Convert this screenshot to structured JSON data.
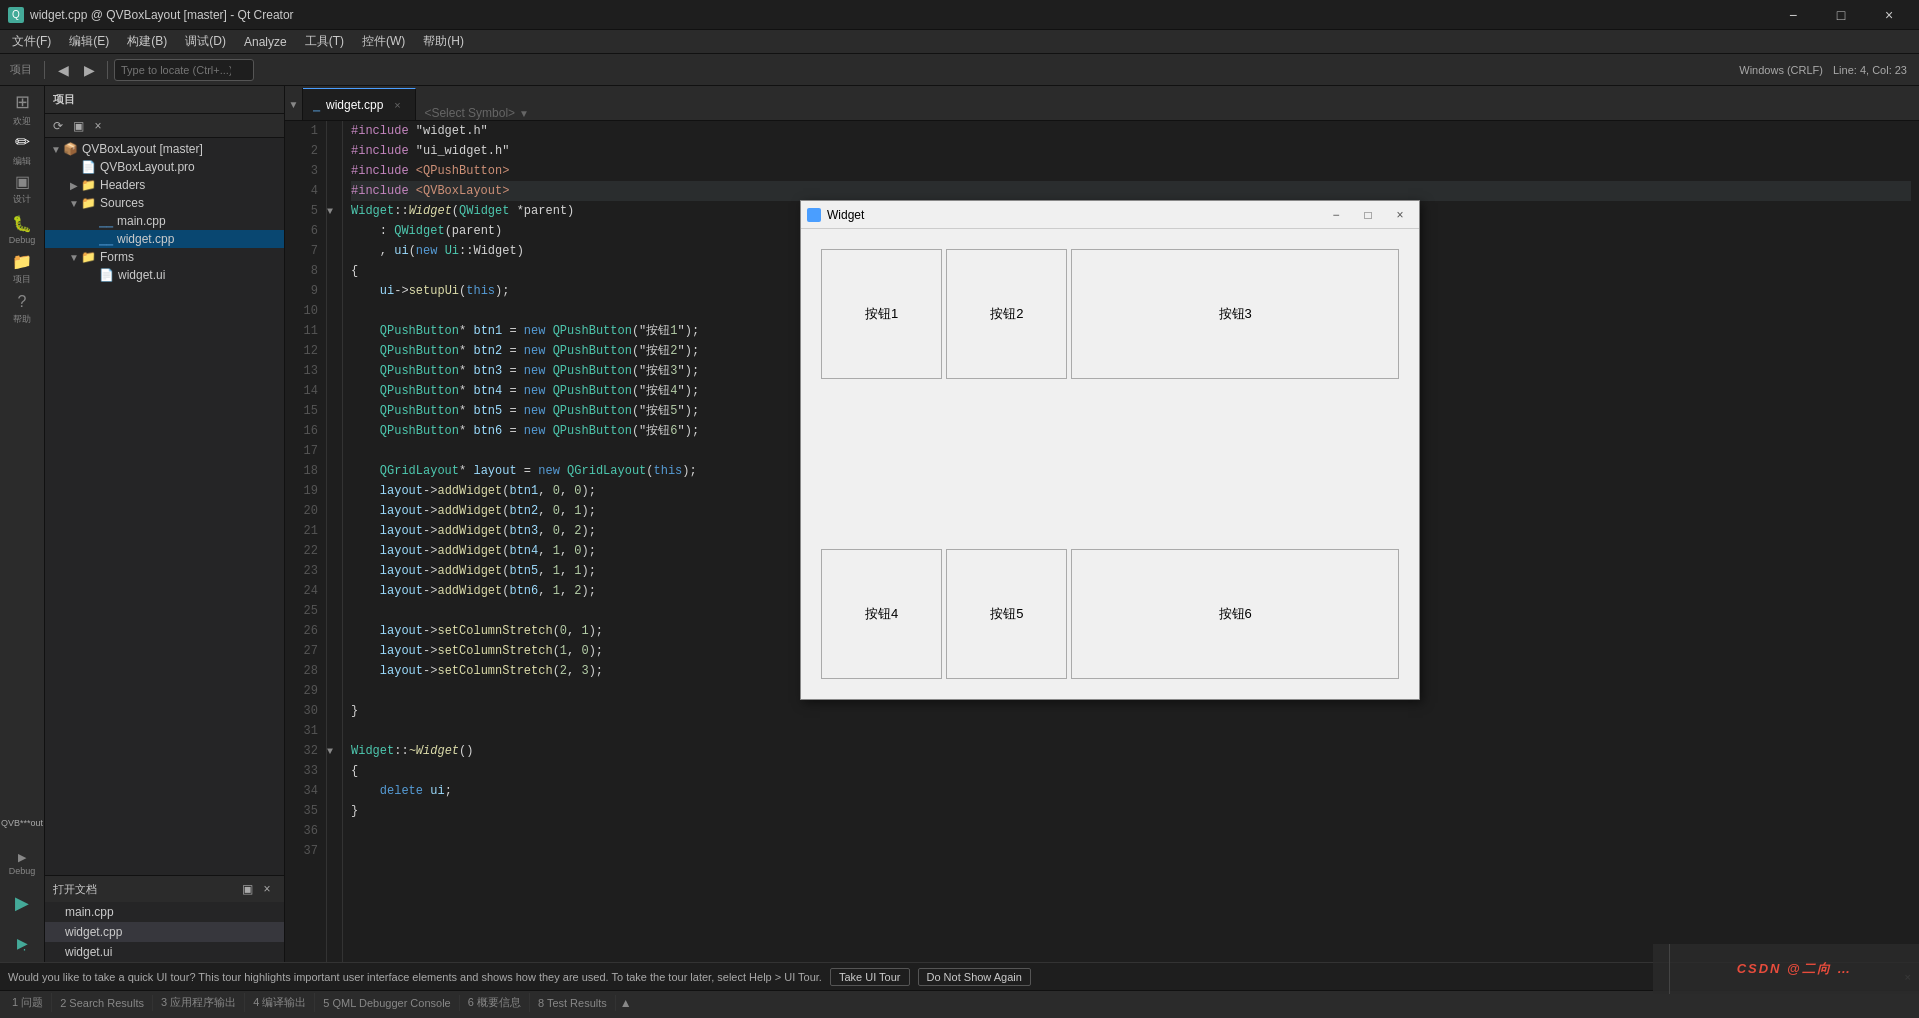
{
  "titlebar": {
    "icon": "Q",
    "title": "widget.cpp @ QVBoxLayout [master] - Qt Creator",
    "min": "−",
    "max": "□",
    "close": "×"
  },
  "menubar": {
    "items": [
      "文件(F)",
      "编辑(E)",
      "构建(B)",
      "调试(D)",
      "Analyze",
      "工具(T)",
      "控件(W)",
      "帮助(H)"
    ]
  },
  "toolbar": {
    "project_label": "项目",
    "search_placeholder": "Type to locate (Ctrl+...)",
    "nav_back": "◀",
    "nav_fwd": "▶",
    "windows_mode": "Windows (CRLF)",
    "line_col": "Line: 4, Col: 23"
  },
  "project_panel": {
    "title": "项目",
    "root": "QVBoxLayout [master]",
    "items": [
      {
        "label": "QVBoxLayout.pro",
        "indent": 1,
        "type": "file",
        "icon": "📄"
      },
      {
        "label": "Headers",
        "indent": 1,
        "type": "folder",
        "icon": "📁",
        "expanded": false
      },
      {
        "label": "Sources",
        "indent": 1,
        "type": "folder",
        "icon": "📁",
        "expanded": true
      },
      {
        "label": "main.cpp",
        "indent": 2,
        "type": "cpp",
        "icon": "📄"
      },
      {
        "label": "widget.cpp",
        "indent": 2,
        "type": "cpp",
        "icon": "📄",
        "selected": true
      },
      {
        "label": "Forms",
        "indent": 1,
        "type": "folder",
        "icon": "📁",
        "expanded": true
      },
      {
        "label": "widget.ui",
        "indent": 2,
        "type": "ui",
        "icon": "📄"
      }
    ]
  },
  "open_files": {
    "title": "打开文档",
    "files": [
      {
        "label": "main.cpp",
        "active": false
      },
      {
        "label": "widget.cpp",
        "active": true
      },
      {
        "label": "widget.ui",
        "active": false
      }
    ]
  },
  "tabs": {
    "items": [
      {
        "label": "widget.cpp",
        "active": true
      },
      {
        "label": "<Select Symbol>",
        "active": false
      }
    ]
  },
  "code": {
    "filename": "widget.cpp",
    "lines": [
      {
        "n": 1,
        "text": "#include \"widget.h\""
      },
      {
        "n": 2,
        "text": "#include \"ui_widget.h\""
      },
      {
        "n": 3,
        "text": "#include <QPushButton>"
      },
      {
        "n": 4,
        "text": "#include <QVBoxLayout>"
      },
      {
        "n": 5,
        "text": "Widget::Widget(QWidget *parent)"
      },
      {
        "n": 6,
        "text": "    : QWidget(parent)"
      },
      {
        "n": 7,
        "text": "    , ui(new Ui::Widget)"
      },
      {
        "n": 8,
        "text": "{"
      },
      {
        "n": 9,
        "text": "    ui->setupUi(this);"
      },
      {
        "n": 10,
        "text": ""
      },
      {
        "n": 11,
        "text": "    QPushButton* btn1 = new QPushButton(\"按钮1\");"
      },
      {
        "n": 12,
        "text": "    QPushButton* btn2 = new QPushButton(\"按钮2\");"
      },
      {
        "n": 13,
        "text": "    QPushButton* btn3 = new QPushButton(\"按钮3\");"
      },
      {
        "n": 14,
        "text": "    QPushButton* btn4 = new QPushButton(\"按钮4\");"
      },
      {
        "n": 15,
        "text": "    QPushButton* btn5 = new QPushButton(\"按钮5\");"
      },
      {
        "n": 16,
        "text": "    QPushButton* btn6 = new QPushButton(\"按钮6\");"
      },
      {
        "n": 17,
        "text": ""
      },
      {
        "n": 18,
        "text": "    QGridLayout* layout = new QGridLayout(this);"
      },
      {
        "n": 19,
        "text": "    layout->addWidget(btn1, 0, 0);"
      },
      {
        "n": 20,
        "text": "    layout->addWidget(btn2, 0, 1);"
      },
      {
        "n": 21,
        "text": "    layout->addWidget(btn3, 0, 2);"
      },
      {
        "n": 22,
        "text": "    layout->addWidget(btn4, 1, 0);"
      },
      {
        "n": 23,
        "text": "    layout->addWidget(btn5, 1, 1);"
      },
      {
        "n": 24,
        "text": "    layout->addWidget(btn6, 1, 2);"
      },
      {
        "n": 25,
        "text": ""
      },
      {
        "n": 26,
        "text": "    layout->setColumnStretch(0, 1);"
      },
      {
        "n": 27,
        "text": "    layout->setColumnStretch(1, 0);"
      },
      {
        "n": 28,
        "text": "    layout->setColumnStretch(2, 3);"
      },
      {
        "n": 29,
        "text": ""
      },
      {
        "n": 30,
        "text": "}"
      },
      {
        "n": 31,
        "text": ""
      },
      {
        "n": 32,
        "text": "Widget::~Widget()"
      },
      {
        "n": 33,
        "text": "{"
      },
      {
        "n": 34,
        "text": "    delete ui;"
      },
      {
        "n": 35,
        "text": "}"
      },
      {
        "n": 36,
        "text": ""
      },
      {
        "n": 37,
        "text": ""
      }
    ]
  },
  "widget_preview": {
    "title": "Widget",
    "icon": "🖼",
    "buttons_row1": [
      "按钮1",
      "按钮2",
      "按钮3"
    ],
    "buttons_row2": [
      "按钮4",
      "按钮5",
      "按钮6"
    ]
  },
  "bottom_tabs": {
    "items": [
      {
        "label": "1 问题",
        "active": false
      },
      {
        "label": "2 Search Results",
        "active": false
      },
      {
        "label": "3 应用程序输出",
        "active": false
      },
      {
        "label": "4 编译输出",
        "active": false
      },
      {
        "label": "5 QML Debugger Console",
        "active": false
      },
      {
        "label": "6 概要信息",
        "active": false
      },
      {
        "label": "8 Test Results",
        "active": false
      }
    ]
  },
  "notification": {
    "text": "Would you like to take a quick UI tour? This tour highlights important user interface elements and shows how they are used. To take the tour later, select Help > UI Tour.",
    "btn1": "Take UI Tour",
    "btn2": "Do Not Show Again",
    "close": "×"
  },
  "statusbar": {
    "left": "",
    "windows_crlf": "Windows (CRLF)",
    "line_col": "Line: 4, Col: 23"
  },
  "left_icons": [
    {
      "icon": "⊞",
      "label": "欢迎"
    },
    {
      "icon": "✏",
      "label": "编辑"
    },
    {
      "icon": "🎨",
      "label": "设计"
    },
    {
      "icon": "🐛",
      "label": "Debug"
    },
    {
      "icon": "📁",
      "label": "项目"
    },
    {
      "icon": "?",
      "label": "帮助"
    }
  ],
  "bottom_left_icons": [
    {
      "icon": "▶",
      "label": ""
    },
    {
      "icon": "▶̂",
      "label": ""
    }
  ],
  "qvb_label": "QVB***out",
  "debug_label": "Debug"
}
